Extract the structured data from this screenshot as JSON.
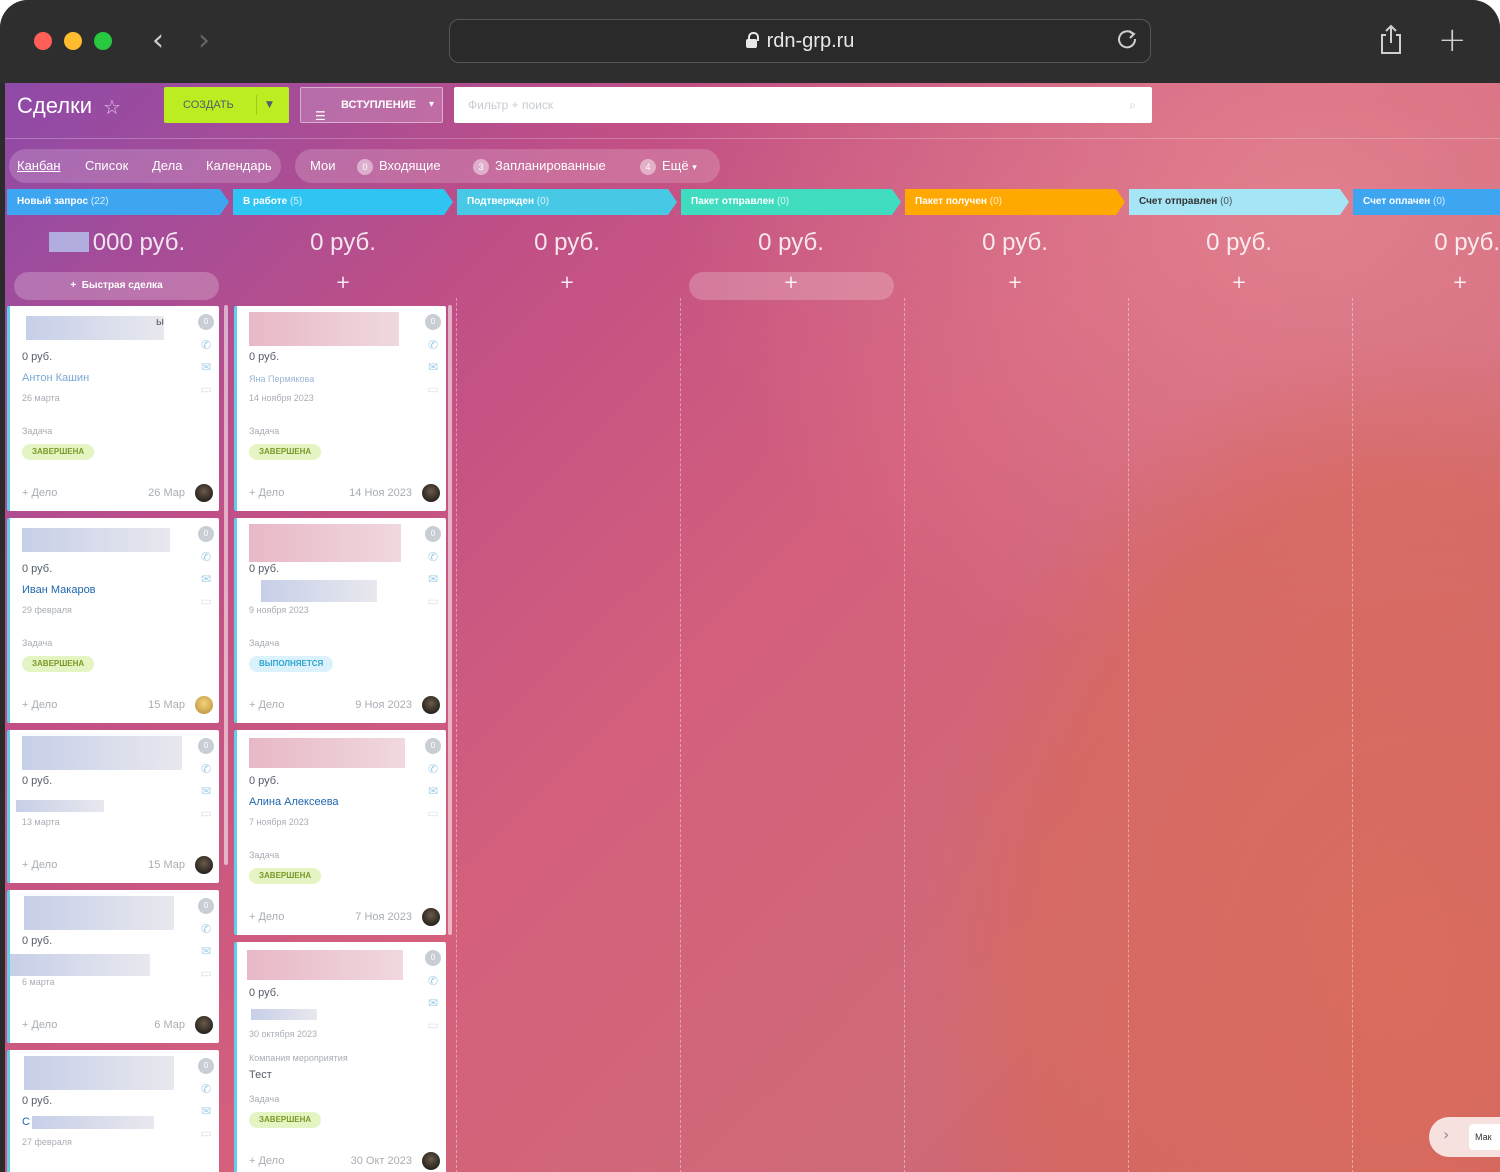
{
  "browser": {
    "url": "rdn-grp.ru",
    "back": "‹",
    "forward": "›",
    "new_tab": "+"
  },
  "toolbar": {
    "title": "Сделки",
    "create_label": "СОЗДАТЬ",
    "filter_label": "ВСТУПЛЕНИЕ",
    "search_placeholder": "Фильтр + поиск"
  },
  "views": {
    "kanban": "Канбан",
    "list": "Список",
    "tasks": "Дела",
    "calendar": "Календарь",
    "mine": "Мои",
    "incoming_count": "0",
    "incoming": "Входящие",
    "planned_count": "3",
    "planned": "Запланированные",
    "more_count": "4",
    "more": "Ещё"
  },
  "columns": [
    {
      "title": "Новый запрос",
      "count": "(22)",
      "color": "#3ea6f0",
      "sum": "000 руб."
    },
    {
      "title": "В работе",
      "count": "(5)",
      "color": "#2fc4f2",
      "sum": "0 руб."
    },
    {
      "title": "Подтвержден",
      "count": "(0)",
      "color": "#47c9e5",
      "sum": "0 руб."
    },
    {
      "title": "Пакет отправлен",
      "count": "(0)",
      "color": "#3fdcc0",
      "sum": "0 руб."
    },
    {
      "title": "Пакет получен",
      "count": "(0)",
      "color": "#ffa900",
      "sum": "0 руб."
    },
    {
      "title": "Счет отправлен",
      "count": "(0)",
      "color": "#a6e5f6",
      "sum": "0 руб."
    },
    {
      "title": "Счет оплачен",
      "count": "(0)",
      "color": "#3ea6f0",
      "sum": "0 руб."
    }
  ],
  "quick_deal": "Быстрая сделка",
  "col_add": "+",
  "cards_col1": [
    {
      "title_tail": "ы",
      "price": "0 руб.",
      "contact": "Антон Кашин",
      "date": "26 марта",
      "task_label": "Задача",
      "badge": "ЗАВЕРШЕНА",
      "add": "+ Дело",
      "activity_date": "26 Мар"
    },
    {
      "price": "0 руб.",
      "contact": "Иван Макаров",
      "date": "29 февраля",
      "task_label": "Задача",
      "badge": "ЗАВЕРШЕНА",
      "add": "+ Дело",
      "activity_date": "15 Мар"
    },
    {
      "price": "0 руб.",
      "date": "13 марта",
      "add": "+ Дело",
      "activity_date": "15 Мар"
    },
    {
      "price": "0 руб.",
      "date": "6 марта",
      "add": "+ Дело",
      "activity_date": "6 Мар"
    },
    {
      "price": "0 руб.",
      "contact": "С",
      "date": "27 февраля"
    }
  ],
  "cards_col2": [
    {
      "price": "0 руб.",
      "contact": "Яна Пермякова",
      "date": "14 ноября 2023",
      "task_label": "Задача",
      "badge": "ЗАВЕРШЕНА",
      "add": "+ Дело",
      "activity_date": "14 Ноя 2023"
    },
    {
      "price": "0 руб.",
      "date": "9 ноября 2023",
      "task_label": "Задача",
      "badge": "ВЫПОЛНЯЕТСЯ",
      "add": "+ Дело",
      "activity_date": "9 Ноя 2023"
    },
    {
      "price": "0 руб.",
      "contact": "Алина Алексеева",
      "date": "7 ноября 2023",
      "task_label": "Задача",
      "badge": "ЗАВЕРШЕНА",
      "add": "+ Дело",
      "activity_date": "7 Ноя 2023"
    },
    {
      "price": "0 руб.",
      "date": "30 октября 2023",
      "campaign_label": "Компания мероприятия",
      "campaign": "Тест",
      "task_label": "Задача",
      "badge": "ЗАВЕРШЕНА",
      "add": "+ Дело",
      "activity_date": "30 Окт 2023"
    }
  ],
  "chat_preview": "Мак"
}
